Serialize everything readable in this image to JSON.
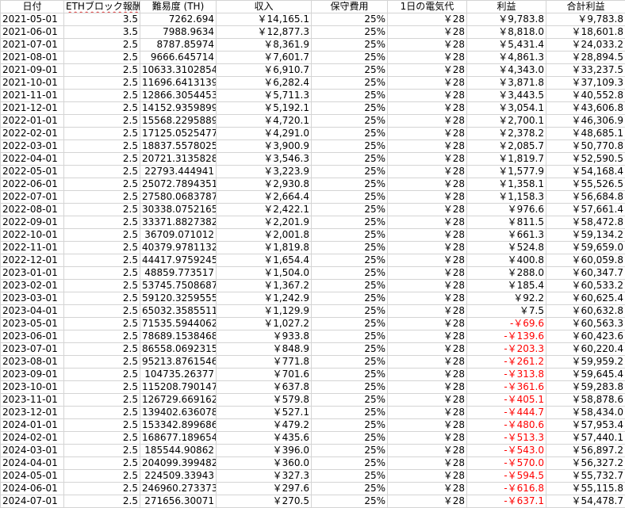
{
  "columns": [
    "日付",
    "ETHブロック報酬",
    "難易度 (TH)",
    "収入",
    "保守費用",
    "1日の電気代",
    "利益",
    "合計利益"
  ],
  "rows": [
    [
      "2021-05-01",
      "3.5",
      "7262.694",
      "￥14,165.1",
      "25%",
      "￥28",
      "￥9,783.8",
      "￥9,783.8"
    ],
    [
      "2021-06-01",
      "3.5",
      "7988.9634",
      "￥12,877.3",
      "25%",
      "￥28",
      "￥8,818.0",
      "￥18,601.8"
    ],
    [
      "2021-07-01",
      "2.5",
      "8787.85974",
      "￥8,361.9",
      "25%",
      "￥28",
      "￥5,431.4",
      "￥24,033.2"
    ],
    [
      "2021-08-01",
      "2.5",
      "9666.645714",
      "￥7,601.7",
      "25%",
      "￥28",
      "￥4,861.3",
      "￥28,894.5"
    ],
    [
      "2021-09-01",
      "2.5",
      "10633.3102854",
      "￥6,910.7",
      "25%",
      "￥28",
      "￥4,343.0",
      "￥33,237.5"
    ],
    [
      "2021-10-01",
      "2.5",
      "11696.6413139",
      "￥6,282.4",
      "25%",
      "￥28",
      "￥3,871.8",
      "￥37,109.3"
    ],
    [
      "2021-11-01",
      "2.5",
      "12866.3054453",
      "￥5,711.3",
      "25%",
      "￥28",
      "￥3,443.5",
      "￥40,552.8"
    ],
    [
      "2021-12-01",
      "2.5",
      "14152.9359899",
      "￥5,192.1",
      "25%",
      "￥28",
      "￥3,054.1",
      "￥43,606.8"
    ],
    [
      "2022-01-01",
      "2.5",
      "15568.2295889",
      "￥4,720.1",
      "25%",
      "￥28",
      "￥2,700.1",
      "￥46,306.9"
    ],
    [
      "2022-02-01",
      "2.5",
      "17125.0525477",
      "￥4,291.0",
      "25%",
      "￥28",
      "￥2,378.2",
      "￥48,685.1"
    ],
    [
      "2022-03-01",
      "2.5",
      "18837.5578025",
      "￥3,900.9",
      "25%",
      "￥28",
      "￥2,085.7",
      "￥50,770.8"
    ],
    [
      "2022-04-01",
      "2.5",
      "20721.3135828",
      "￥3,546.3",
      "25%",
      "￥28",
      "￥1,819.7",
      "￥52,590.5"
    ],
    [
      "2022-05-01",
      "2.5",
      "22793.444941",
      "￥3,223.9",
      "25%",
      "￥28",
      "￥1,577.9",
      "￥54,168.4"
    ],
    [
      "2022-06-01",
      "2.5",
      "25072.7894351",
      "￥2,930.8",
      "25%",
      "￥28",
      "￥1,358.1",
      "￥55,526.5"
    ],
    [
      "2022-07-01",
      "2.5",
      "27580.0683787",
      "￥2,664.4",
      "25%",
      "￥28",
      "￥1,158.3",
      "￥56,684.8"
    ],
    [
      "2022-08-01",
      "2.5",
      "30338.0752165",
      "￥2,422.1",
      "25%",
      "￥28",
      "￥976.6",
      "￥57,661.4"
    ],
    [
      "2022-09-01",
      "2.5",
      "33371.8827382",
      "￥2,201.9",
      "25%",
      "￥28",
      "￥811.5",
      "￥58,472.8"
    ],
    [
      "2022-10-01",
      "2.5",
      "36709.071012",
      "￥2,001.8",
      "25%",
      "￥28",
      "￥661.3",
      "￥59,134.2"
    ],
    [
      "2022-11-01",
      "2.5",
      "40379.9781132",
      "￥1,819.8",
      "25%",
      "￥28",
      "￥524.8",
      "￥59,659.0"
    ],
    [
      "2022-12-01",
      "2.5",
      "44417.9759245",
      "￥1,654.4",
      "25%",
      "￥28",
      "￥400.8",
      "￥60,059.8"
    ],
    [
      "2023-01-01",
      "2.5",
      "48859.773517",
      "￥1,504.0",
      "25%",
      "￥28",
      "￥288.0",
      "￥60,347.7"
    ],
    [
      "2023-02-01",
      "2.5",
      "53745.7508687",
      "￥1,367.2",
      "25%",
      "￥28",
      "￥185.4",
      "￥60,533.2"
    ],
    [
      "2023-03-01",
      "2.5",
      "59120.3259555",
      "￥1,242.9",
      "25%",
      "￥28",
      "￥92.2",
      "￥60,625.4"
    ],
    [
      "2023-04-01",
      "2.5",
      "65032.3585511",
      "￥1,129.9",
      "25%",
      "￥28",
      "￥7.5",
      "￥60,632.8"
    ],
    [
      "2023-05-01",
      "2.5",
      "71535.5944062",
      "￥1,027.2",
      "25%",
      "￥28",
      "-￥69.6",
      "￥60,563.3"
    ],
    [
      "2023-06-01",
      "2.5",
      "78689.1538468",
      "￥933.8",
      "25%",
      "￥28",
      "-￥139.6",
      "￥60,423.6"
    ],
    [
      "2023-07-01",
      "2.5",
      "86558.0692315",
      "￥848.9",
      "25%",
      "￥28",
      "-￥203.3",
      "￥60,220.4"
    ],
    [
      "2023-08-01",
      "2.5",
      "95213.8761546",
      "￥771.8",
      "25%",
      "￥28",
      "-￥261.2",
      "￥59,959.2"
    ],
    [
      "2023-09-01",
      "2.5",
      "104735.26377",
      "￥701.6",
      "25%",
      "￥28",
      "-￥313.8",
      "￥59,645.4"
    ],
    [
      "2023-10-01",
      "2.5",
      "115208.790147",
      "￥637.8",
      "25%",
      "￥28",
      "-￥361.6",
      "￥59,283.8"
    ],
    [
      "2023-11-01",
      "2.5",
      "126729.669162",
      "￥579.8",
      "25%",
      "￥28",
      "-￥405.1",
      "￥58,878.6"
    ],
    [
      "2023-12-01",
      "2.5",
      "139402.636078",
      "￥527.1",
      "25%",
      "￥28",
      "-￥444.7",
      "￥58,434.0"
    ],
    [
      "2024-01-01",
      "2.5",
      "153342.899686",
      "￥479.2",
      "25%",
      "￥28",
      "-￥480.6",
      "￥57,953.4"
    ],
    [
      "2024-02-01",
      "2.5",
      "168677.189654",
      "￥435.6",
      "25%",
      "￥28",
      "-￥513.3",
      "￥57,440.1"
    ],
    [
      "2024-03-01",
      "2.5",
      "185544.90862",
      "￥396.0",
      "25%",
      "￥28",
      "-￥543.0",
      "￥56,897.2"
    ],
    [
      "2024-04-01",
      "2.5",
      "204099.399482",
      "￥360.0",
      "25%",
      "￥28",
      "-￥570.0",
      "￥56,327.2"
    ],
    [
      "2024-05-01",
      "2.5",
      "224509.33943",
      "￥327.3",
      "25%",
      "￥28",
      "-￥594.5",
      "￥55,732.7"
    ],
    [
      "2024-06-01",
      "2.5",
      "246960.273373",
      "￥297.6",
      "25%",
      "￥28",
      "-￥616.8",
      "￥55,115.8"
    ],
    [
      "2024-07-01",
      "2.5",
      "271656.30071",
      "￥270.5",
      "25%",
      "￥28",
      "-￥637.1",
      "￥54,478.7"
    ]
  ],
  "colors": {
    "negative": "#ff0000",
    "grid": "#d4d4d4",
    "spellcheck": "#e05050"
  }
}
